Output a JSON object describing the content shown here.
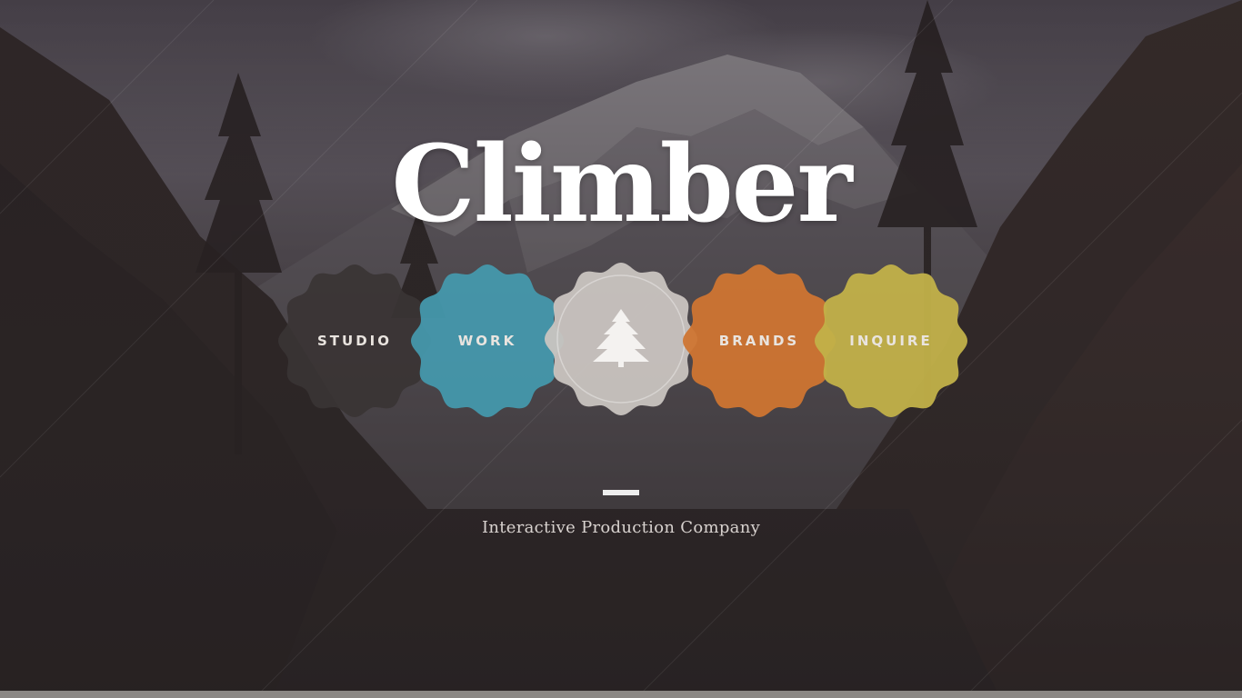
{
  "brand": {
    "title": "Climber",
    "tagline": "Interactive Production Company"
  },
  "nav": {
    "items": [
      {
        "label": "STUDIO",
        "color": "#3a3434"
      },
      {
        "label": "WORK",
        "color": "#4598ac"
      },
      {
        "icon": "pine-tree-logo-icon",
        "color": "#c9c4c0"
      },
      {
        "label": "BRANDS",
        "color": "#cf7532"
      },
      {
        "label": "INQUIRE",
        "color": "#c2b149"
      }
    ]
  },
  "colors": {
    "overlay": "#2e2829",
    "sky": "#8a8294",
    "snow": "#d7d4dc",
    "forest": "#2a2223",
    "accent_dash": "#eeeeee"
  }
}
